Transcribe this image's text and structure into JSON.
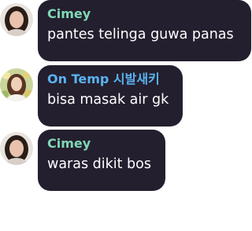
{
  "colors": {
    "bubble": "#241f2e",
    "message_text": "#ffffff",
    "name_cimey": "#7fd8b6",
    "name_ontemp": "#5ab3f2"
  },
  "messages": [
    {
      "sender": "Cimey",
      "text": "pantes telinga guwa panas",
      "avatar_icon": "avatar-photo-girl-dark-hair"
    },
    {
      "sender": "On Temp 시발새키",
      "text": "bisa masak air gk",
      "avatar_icon": "avatar-photo-girl-with-flowers"
    },
    {
      "sender": "Cimey",
      "text": "waras dikit bos",
      "avatar_icon": "avatar-photo-girl-dark-hair"
    }
  ]
}
